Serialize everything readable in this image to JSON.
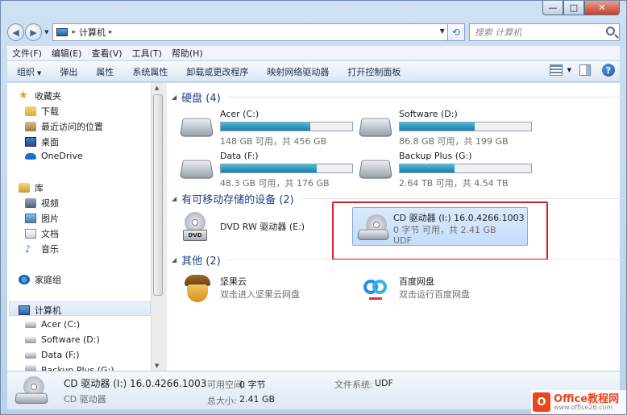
{
  "window": {
    "min": "—",
    "max": "□",
    "close": "✕"
  },
  "address": {
    "root_label": "计算机",
    "search_placeholder": "搜索 计算机"
  },
  "menu": [
    "文件(F)",
    "编辑(E)",
    "查看(V)",
    "工具(T)",
    "帮助(H)"
  ],
  "toolbar": {
    "organize": "组织",
    "items": [
      "弹出",
      "属性",
      "系统属性",
      "卸载或更改程序",
      "映射网络驱动器",
      "打开控制面板"
    ]
  },
  "sidebar": {
    "favorites": "收藏夹",
    "fav_items": [
      "下载",
      "最近访问的位置",
      "桌面",
      "OneDrive"
    ],
    "library": "库",
    "lib_items": [
      "视频",
      "图片",
      "文档",
      "音乐"
    ],
    "homegroup": "家庭组",
    "computer": "计算机",
    "comp_items": [
      "Acer (C:)",
      "Software (D:)",
      "Data (F:)",
      "Backup Plus (G:)"
    ]
  },
  "groups": {
    "hdd": "硬盘 (4)",
    "removable": "有可移动存储的设备 (2)",
    "other": "其他 (2)"
  },
  "drives": [
    {
      "name": "Acer (C:)",
      "detail": "148 GB 可用，共 456 GB",
      "used": 0.68
    },
    {
      "name": "Software (D:)",
      "detail": "86.8 GB 可用，共 199 GB",
      "used": 0.57
    },
    {
      "name": "Data (F:)",
      "detail": "48.3 GB 可用，共 176 GB",
      "used": 0.73
    },
    {
      "name": "Backup Plus (G:)",
      "detail": "2.64 TB 可用，共 4.54 TB",
      "used": 0.42
    }
  ],
  "dvd": {
    "name": "DVD RW 驱动器 (E:)",
    "badge": "DVD"
  },
  "cd": {
    "name": "CD 驱动器 (I:) 16.0.4266.1003",
    "detail": "0 字节 可用，共 2.41 GB",
    "fs": "UDF"
  },
  "other": [
    {
      "name": "坚果云",
      "desc": "双击进入坚果云网盘"
    },
    {
      "name": "百度网盘",
      "desc": "双击运行百度网盘"
    }
  ],
  "status": {
    "name": "CD 驱动器 (I:) 16.0.4266.1003",
    "type": "CD 驱动器",
    "free_label": "可用空间:",
    "free_value": "0 字节",
    "total_label": "总大小:",
    "total_value": "2.41 GB",
    "fs_label": "文件系统:",
    "fs_value": "UDF"
  },
  "watermark": {
    "main": "Office教程网",
    "url": "www.office26.com"
  },
  "colors": {
    "accent": "#1e3f8a",
    "highlight": "#e01e26",
    "bar": "#2a94bf"
  }
}
